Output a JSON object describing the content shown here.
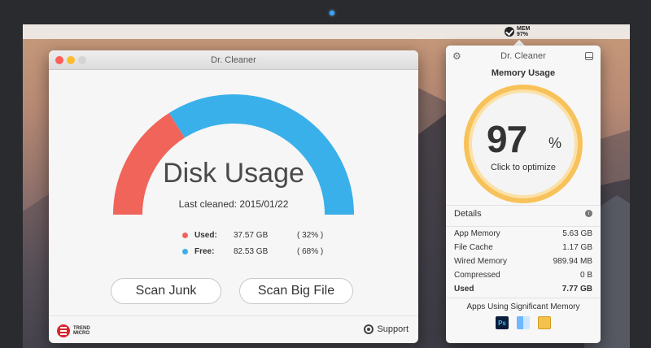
{
  "menubar": {
    "mem_label": "MEM",
    "mem_value": "97%"
  },
  "main_window": {
    "title": "Dr. Cleaner",
    "disk_title": "Disk Usage",
    "last_cleaned": "Last cleaned: 2015/01/22",
    "legend": [
      {
        "label": "Used:",
        "value": "37.57 GB",
        "percent": "( 32% )",
        "color": "#f0645a"
      },
      {
        "label": "Free:",
        "value": "82.53 GB",
        "percent": "( 68% )",
        "color": "#3ab0ea"
      }
    ],
    "gauge": {
      "used_fraction": 0.32,
      "used_color": "#f0645a",
      "free_color": "#3ab0ea"
    },
    "buttons": {
      "scan_junk": "Scan Junk",
      "scan_big_file": "Scan Big File"
    },
    "footer": {
      "brand_line1": "TREND",
      "brand_line2": "MICRO",
      "support": "Support"
    }
  },
  "popover": {
    "title": "Dr. Cleaner",
    "memory_title": "Memory Usage",
    "percent_number": "97",
    "percent_sign": "%",
    "optimize_label": "Click to optimize",
    "details_label": "Details",
    "details": [
      {
        "label": "App Memory",
        "value": "5.63 GB"
      },
      {
        "label": "File Cache",
        "value": "1.17 GB"
      },
      {
        "label": "Wired Memory",
        "value": "989.94 MB"
      },
      {
        "label": "Compressed",
        "value": "0 B"
      },
      {
        "label": "Used",
        "value": "7.77 GB"
      }
    ],
    "apps_title": "Apps Using Significant Memory",
    "apps": [
      {
        "icon": "photoshop-icon",
        "text": "Ps"
      },
      {
        "icon": "finder-icon",
        "text": ""
      },
      {
        "icon": "preview-icon",
        "text": ""
      }
    ],
    "ring_color": "#f8c25a"
  }
}
